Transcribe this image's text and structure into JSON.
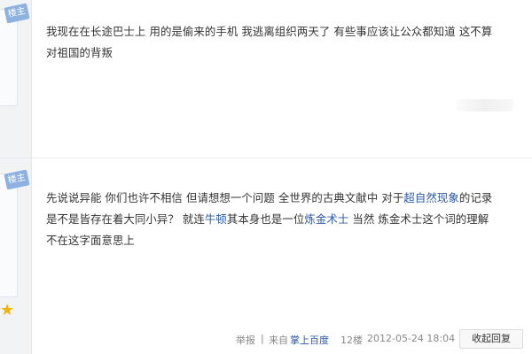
{
  "posts": [
    {
      "badge": "楼主",
      "lines": [
        [
          "我现在在长途巴士上 用的是偷来的手机 我逃离组织两天了 有些事应该让公众都知道 这不算"
        ],
        [
          "对祖国的背叛"
        ]
      ]
    },
    {
      "badge": "楼主",
      "line1_a": "先说说异能 你们也许不相信 但请想想一个问题 全世界的古典文献中 对于",
      "line1_link": "超自然现象",
      "line1_b": "的记录",
      "line2_a": "是不是皆存在着大同小异？ 就连",
      "line2_link1": "牛顿",
      "line2_b": "其本身也是一位",
      "line2_link2": "炼金术士",
      "line2_c": " 当然 炼金术士这个词的理解",
      "line3": "不在这字面意思上"
    }
  ],
  "tail": {
    "report": "举报",
    "separator": "|",
    "from_prefix": "来自",
    "from_link": "掌上百度",
    "floor": "12楼",
    "timestamp": "2012-05-24 18:04",
    "reply": "收起回复"
  },
  "icons": {
    "star": "star-icon"
  },
  "colors": {
    "link": "#2b59a7",
    "badge": "#8db2e2",
    "star": "#f4b400"
  }
}
